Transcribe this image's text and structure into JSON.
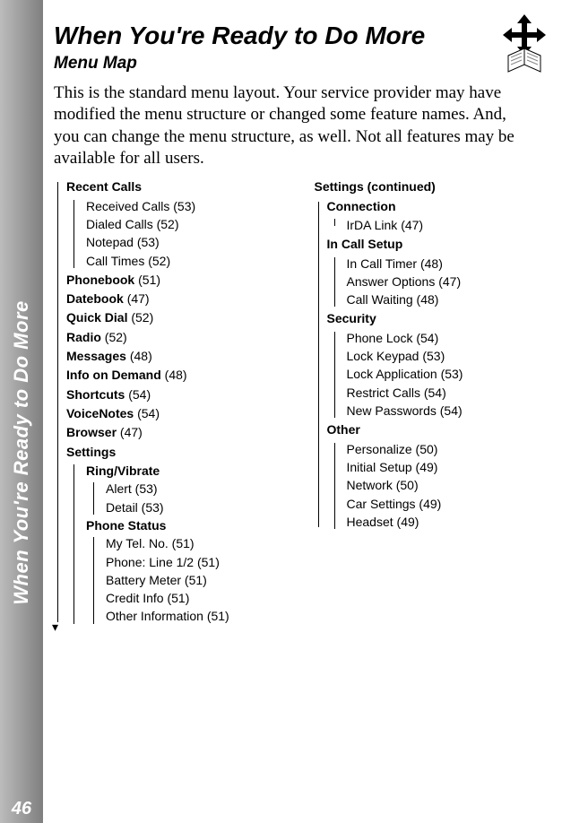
{
  "sidebar": {
    "label": "When You're Ready to Do More",
    "page_number": "46"
  },
  "title": "When You're Ready to Do More",
  "subtitle": "Menu Map",
  "intro": "This is the standard menu layout. Your service provider may have modified the menu structure or changed some feature names. And, you can change the menu structure, as well. Not all features may be available for all users.",
  "left": {
    "recent_calls": {
      "label": "Recent Calls",
      "items": [
        "Received Calls (53)",
        "Dialed Calls (52)",
        "Notepad (53)",
        "Call Times (52)"
      ]
    },
    "phonebook": {
      "label": "Phonebook",
      "page": "(51)"
    },
    "datebook": {
      "label": "Datebook",
      "page": "(47)"
    },
    "quick_dial": {
      "label": "Quick Dial",
      "page": "(52)"
    },
    "radio": {
      "label": "Radio",
      "page": "(52)"
    },
    "messages": {
      "label": "Messages",
      "page": "(48)"
    },
    "info_on_demand": {
      "label": "Info on Demand",
      "page": "(48)"
    },
    "shortcuts": {
      "label": "Shortcuts",
      "page": "(54)"
    },
    "voicenotes": {
      "label": "VoiceNotes",
      "page": "(54)"
    },
    "browser": {
      "label": "Browser",
      "page": "(47)"
    },
    "settings": {
      "label": "Settings",
      "ring_vibrate": {
        "label": "Ring/Vibrate",
        "items": [
          "Alert (53)",
          "Detail (53)"
        ]
      },
      "phone_status": {
        "label": "Phone Status",
        "items": [
          "My Tel. No. (51)",
          "Phone: Line 1/2 (51)",
          "Battery Meter (51)",
          "Credit Info (51)",
          "Other Information (51)"
        ]
      }
    }
  },
  "right": {
    "heading": "Settings (continued)",
    "connection": {
      "label": "Connection",
      "items": [
        "IrDA Link (47)"
      ]
    },
    "in_call_setup": {
      "label": "In Call Setup",
      "items": [
        "In Call Timer (48)",
        "Answer Options (47)",
        "Call Waiting (48)"
      ]
    },
    "security": {
      "label": "Security",
      "items": [
        "Phone Lock (54)",
        "Lock Keypad (53)",
        "Lock Application (53)",
        "Restrict Calls (54)",
        "New Passwords (54)"
      ]
    },
    "other": {
      "label": "Other",
      "items": [
        "Personalize (50)",
        "Initial Setup (49)",
        "Network (50)",
        "Car Settings (49)",
        "Headset (49)"
      ]
    }
  }
}
